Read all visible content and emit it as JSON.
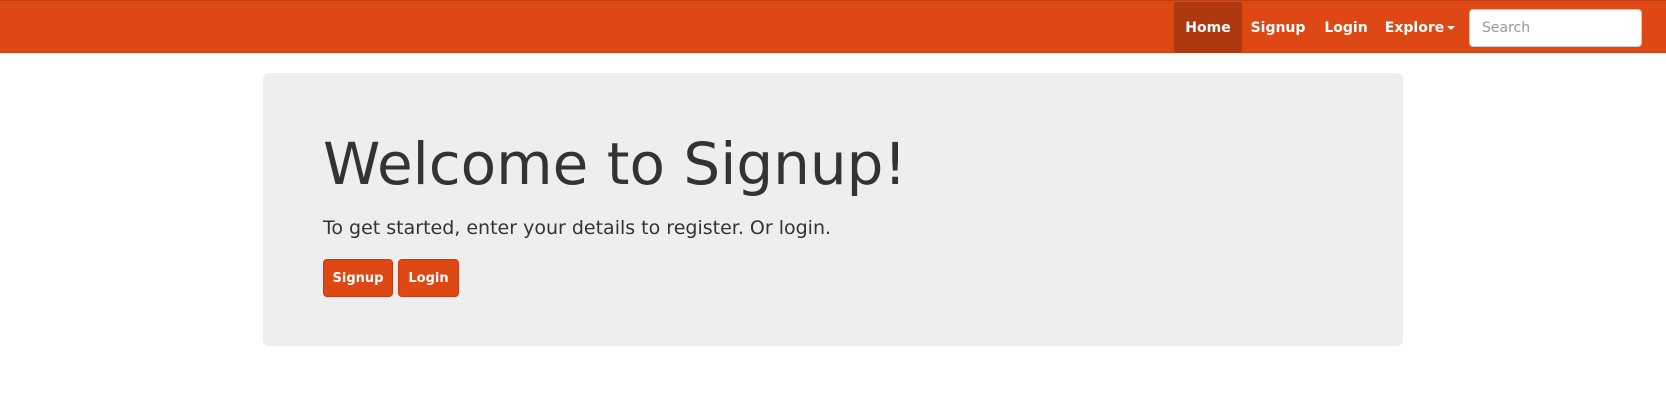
{
  "colors": {
    "brand": "#dd4814",
    "nav_active": "#ae3910",
    "jumbotron_bg": "#eeeeee",
    "text": "#333333"
  },
  "navbar": {
    "items": [
      {
        "label": "Home",
        "active": true
      },
      {
        "label": "Signup",
        "active": false
      },
      {
        "label": "Login",
        "active": false
      },
      {
        "label": "Explore",
        "active": false,
        "icon": "caret-down-icon"
      }
    ],
    "search": {
      "placeholder": "Search",
      "value": ""
    }
  },
  "jumbotron": {
    "title": "Welcome to Signup!",
    "text": "To get started, enter your details to register. Or login.",
    "buttons": {
      "signup_label": "Signup",
      "login_label": "Login"
    }
  }
}
